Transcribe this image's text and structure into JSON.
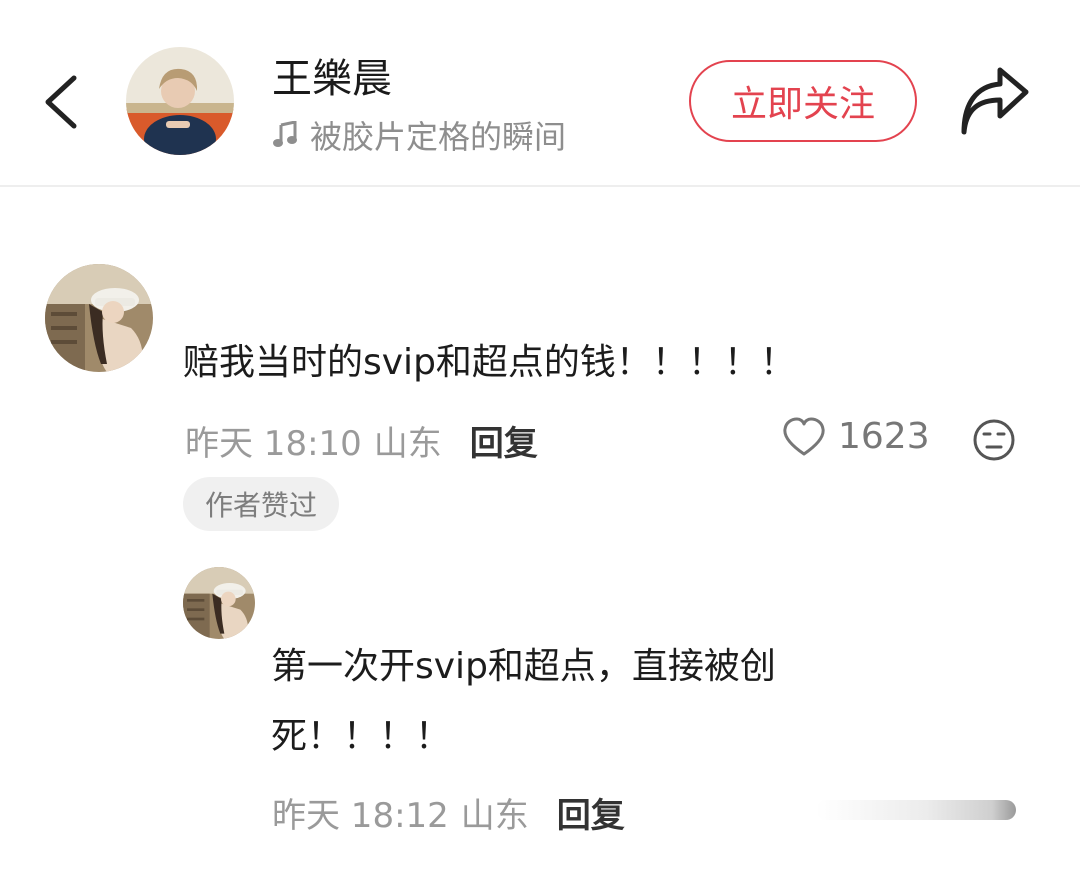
{
  "header": {
    "author_name": "王樂晨",
    "music_title": "被胶片定格的瞬间",
    "follow_label": "立即关注"
  },
  "comments": [
    {
      "text": "赔我当时的svip和超点的钱！！！！！",
      "time": "昨天 18:10",
      "location": "山东",
      "reply_label": "回复",
      "likes": "1623",
      "badge": "作者赞过",
      "replies": [
        {
          "text_lines": [
            "第一次开svip和超点，直接被创",
            "死！！！！"
          ],
          "time": "昨天 18:12",
          "location": "山东",
          "reply_label": "回复"
        }
      ]
    }
  ],
  "icons": {
    "back": "chevron-left-icon",
    "share": "share-arrow-icon",
    "music": "music-note-icon",
    "like": "heart-outline-icon",
    "emoji": "neutral-face-icon"
  },
  "colors": {
    "accent": "#e3434f",
    "secondary_text": "#9a9a9a",
    "badge_bg": "#f0f0f0"
  }
}
